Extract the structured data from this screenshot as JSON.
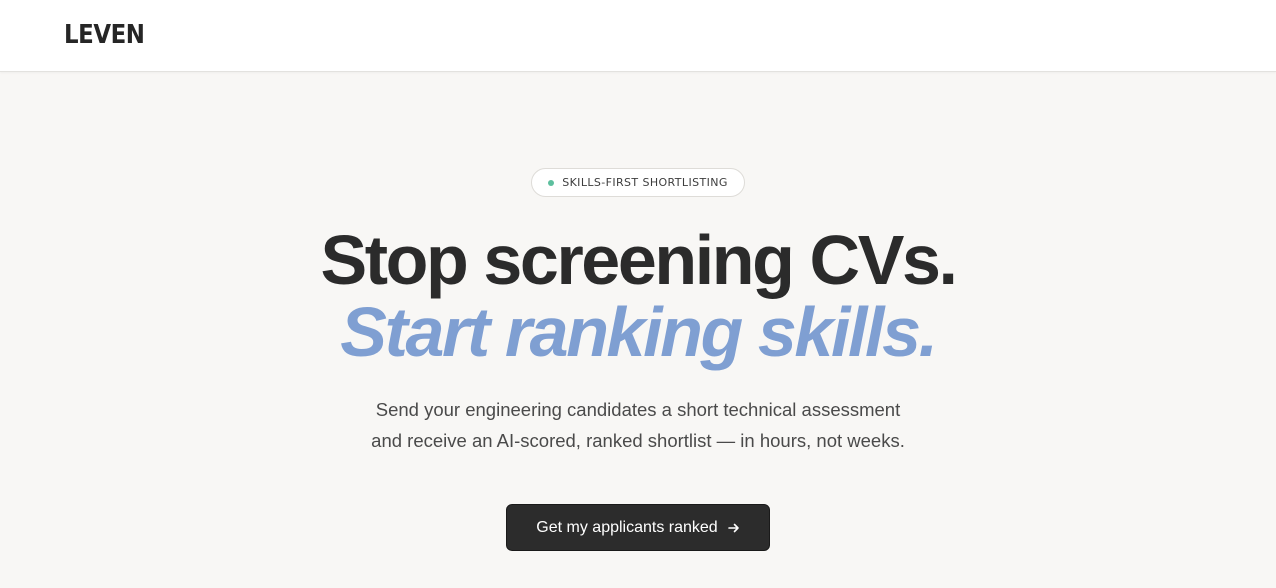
{
  "header": {
    "logo_text": "LEVEN"
  },
  "hero": {
    "badge_label": "SKILLS-FIRST SHORTLISTING",
    "headline": "Stop screening CVs.",
    "subheadline": "Start ranking skills.",
    "description_line1": "Send your engineering candidates a short technical assessment",
    "description_line2": "and receive an AI-scored, ranked shortlist — in hours, not weeks.",
    "cta_label": "Get my applicants ranked",
    "cta_icon": "arrow-right-icon"
  },
  "colors": {
    "background": "#f8f7f5",
    "header_background": "#ffffff",
    "text_dark": "#2b2b2b",
    "accent_blue": "#7f9fd2",
    "badge_dot": "#5dbf9e",
    "cta_background": "#2c2c2c"
  }
}
